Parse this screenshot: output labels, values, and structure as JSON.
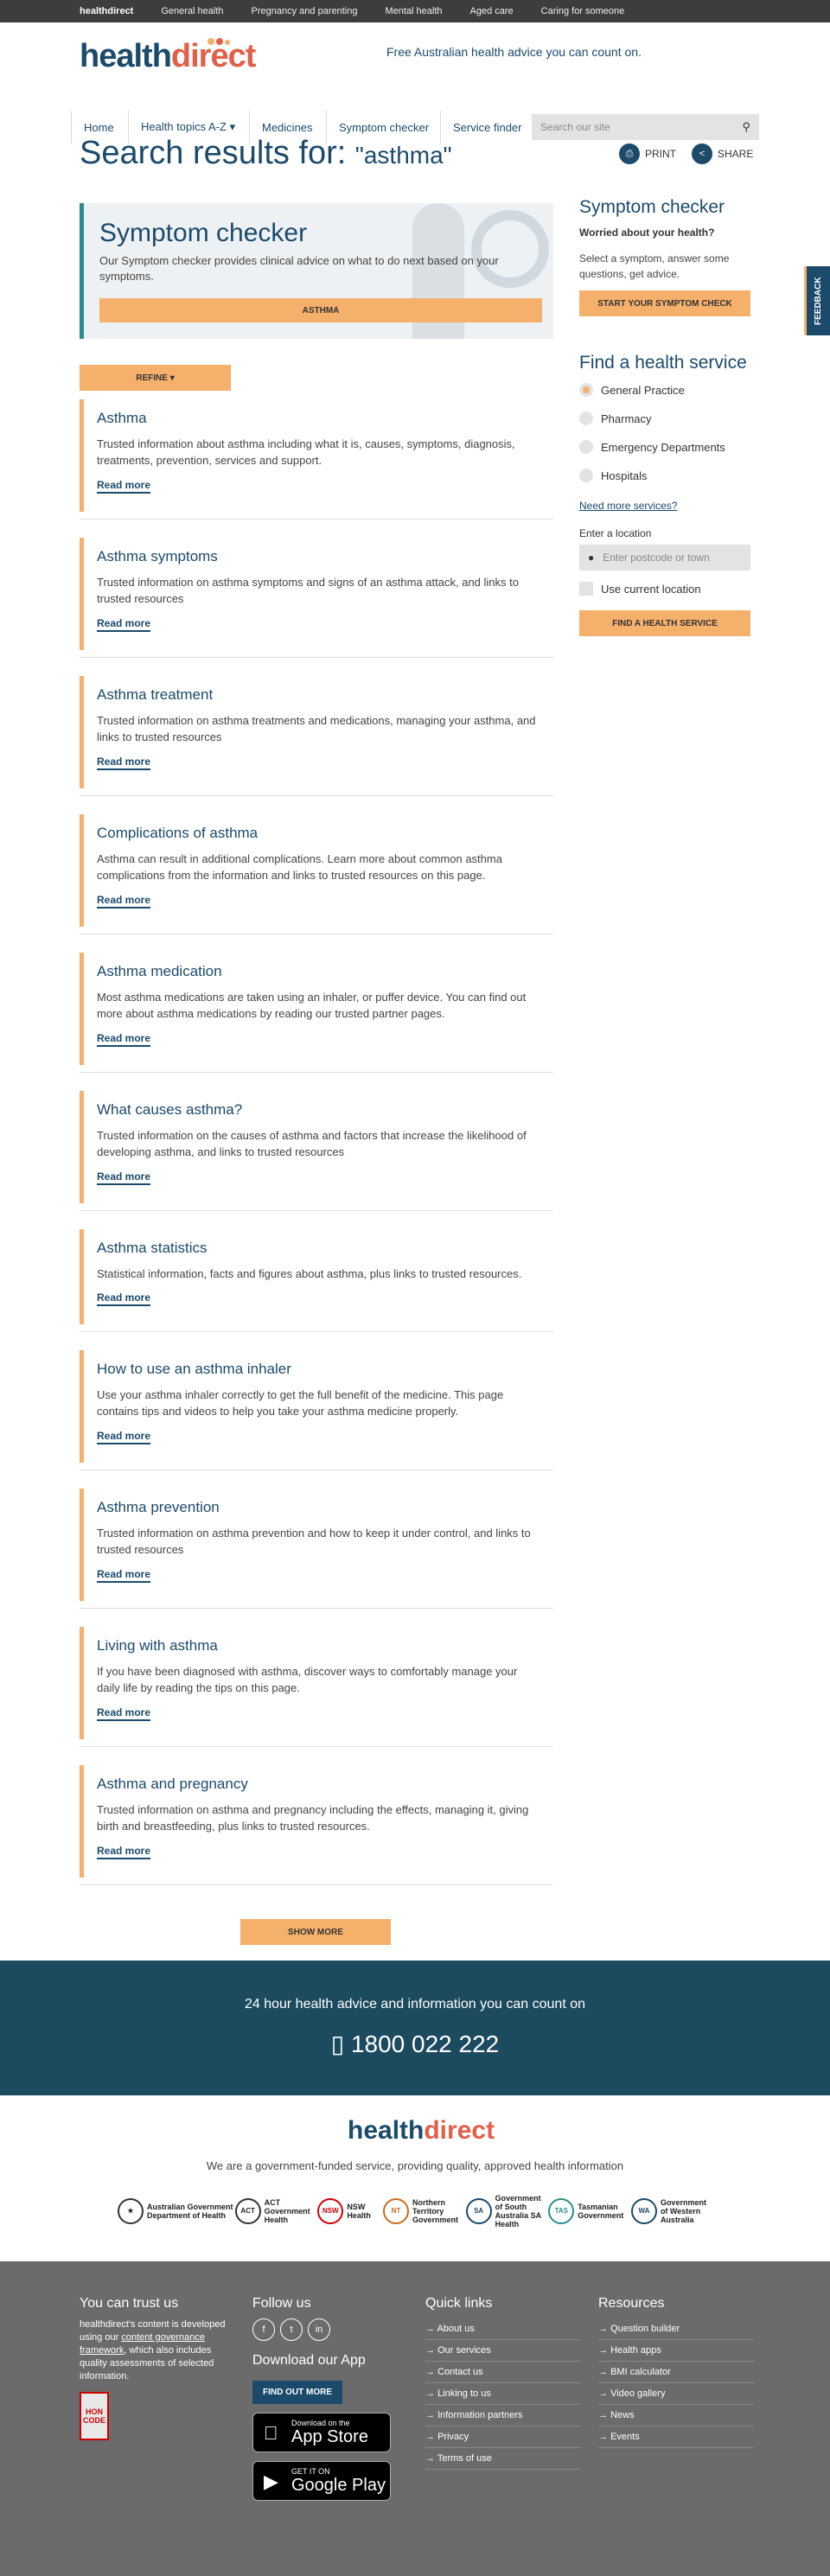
{
  "topbar": {
    "logo": "healthdirect",
    "items": [
      "General health",
      "Pregnancy and parenting",
      "Mental health",
      "Aged care",
      "Caring for someone"
    ]
  },
  "header": {
    "logo_part1": "health",
    "logo_part2": "direct",
    "tagline": "Free Australian health advice you can count on."
  },
  "nav": {
    "items": [
      "Home",
      "Health topics A-Z ▾",
      "Medicines",
      "Symptom checker",
      "Service finder"
    ],
    "search_placeholder": "Search our site"
  },
  "page": {
    "title_prefix": "Search results for:",
    "query": "\"asthma\"",
    "print": "PRINT",
    "share": "SHARE"
  },
  "symptom_box": {
    "title": "Symptom checker",
    "text": "Our Symptom checker provides clinical advice on what to do next based on your symptoms.",
    "button": "ASTHMA"
  },
  "refine": "REFINE ▾",
  "read_more": "Read more",
  "results": [
    {
      "title": "Asthma",
      "desc": "Trusted information about asthma including what it is, causes, symptoms, diagnosis, treatments, prevention, services and support."
    },
    {
      "title": "Asthma symptoms",
      "desc": "Trusted information on asthma symptoms and signs of an asthma attack, and links to trusted resources"
    },
    {
      "title": "Asthma treatment",
      "desc": "Trusted information on asthma treatments and medications, managing your asthma, and links to trusted resources"
    },
    {
      "title": "Complications of asthma",
      "desc": "Asthma can result in additional complications. Learn more about common asthma complications from the information and links to trusted resources on this page."
    },
    {
      "title": "Asthma medication",
      "desc": "Most asthma medications are taken using an inhaler, or puffer device. You can find out more about asthma medications by reading our trusted partner pages."
    },
    {
      "title": "What causes asthma?",
      "desc": "Trusted information on the causes of asthma and factors that increase the likelihood of developing asthma, and links to trusted resources"
    },
    {
      "title": "Asthma statistics",
      "desc": "Statistical information, facts and figures about asthma, plus links to trusted resources."
    },
    {
      "title": "How to use an asthma inhaler",
      "desc": "Use your asthma inhaler correctly to get the full benefit of the medicine. This page contains tips and videos to help you take your asthma medicine properly."
    },
    {
      "title": "Asthma prevention",
      "desc": "Trusted information on asthma prevention and how to keep it under control, and links to trusted resources"
    },
    {
      "title": "Living with asthma",
      "desc": "If you have been diagnosed with asthma, discover ways to comfortably manage your daily life by reading the tips on this page."
    },
    {
      "title": "Asthma and pregnancy",
      "desc": "Trusted information on asthma and pregnancy including the effects, managing it, giving birth and breastfeeding, plus links to trusted resources."
    }
  ],
  "show_more": "SHOW MORE",
  "sidebar": {
    "sc_title": "Symptom checker",
    "sc_sub": "Worried about your health?",
    "sc_text": "Select a symptom, answer some questions, get advice.",
    "sc_button": "START YOUR SYMPTOM CHECK",
    "fs_title": "Find a health service",
    "options": [
      "General Practice",
      "Pharmacy",
      "Emergency Departments",
      "Hospitals"
    ],
    "need_more": "Need more services?",
    "loc_label": "Enter a location",
    "loc_placeholder": "Enter postcode or town",
    "use_current": "Use current location",
    "fs_button": "FIND A HEALTH SERVICE"
  },
  "feedback": "FEEDBACK",
  "phone": {
    "line1": "24 hour health advice and information you can count on",
    "number": "1800 022 222"
  },
  "gov": {
    "tagline": "We are a government-funded service, providing quality, approved health information",
    "logos": [
      "Australian Government Department of Health",
      "ACT Government Health",
      "NSW Health",
      "Northern Territory Government",
      "Government of South Australia SA Health",
      "Tasmanian Government",
      "Government of Western Australia"
    ]
  },
  "footer": {
    "trust_title": "You can trust us",
    "trust_text_1": "healthdirect's content is developed using our",
    "trust_link": "content governance framework",
    "trust_text_2": ", which also includes quality assessments of selected information.",
    "hon": "HON CODE",
    "follow_title": "Follow us",
    "app_title": "Download our App",
    "find_out": "FIND OUT MORE",
    "appstore_small": "Download on the",
    "appstore_big": "App Store",
    "gplay_small": "GET IT ON",
    "gplay_big": "Google Play",
    "quick_title": "Quick links",
    "quick": [
      "About us",
      "Our services",
      "Contact us",
      "Linking to us",
      "Information partners",
      "Privacy",
      "Terms of use"
    ],
    "res_title": "Resources",
    "resources": [
      "Question builder",
      "Health apps",
      "BMI calculator",
      "Video gallery",
      "News",
      "Events"
    ]
  }
}
